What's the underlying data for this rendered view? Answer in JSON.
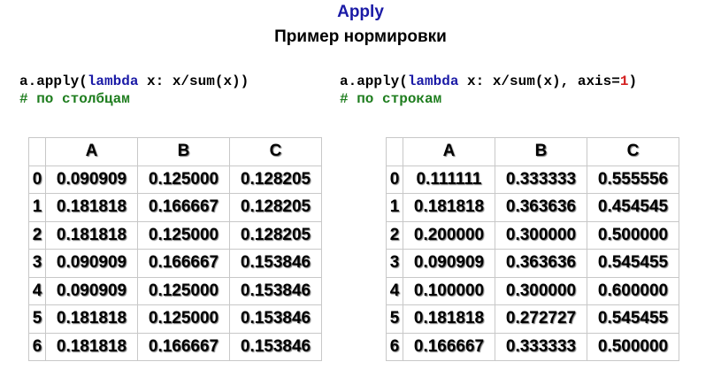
{
  "title": "Apply",
  "subtitle": "Пример нормировки",
  "code_left": {
    "prefix": "a.apply(",
    "keyword": "lambda",
    "suffix": " x: x/sum(x))",
    "comment": "# по столбцам"
  },
  "code_right": {
    "prefix": "a.apply(",
    "keyword": "lambda",
    "middle": " x: x/sum(x), axis=",
    "number": "1",
    "suffix": ")",
    "comment": "# по строкам"
  },
  "table_left": {
    "columns": [
      "",
      "A",
      "B",
      "C"
    ],
    "rows": [
      [
        "0",
        "0.090909",
        "0.125000",
        "0.128205"
      ],
      [
        "1",
        "0.181818",
        "0.166667",
        "0.128205"
      ],
      [
        "2",
        "0.181818",
        "0.125000",
        "0.128205"
      ],
      [
        "3",
        "0.090909",
        "0.166667",
        "0.153846"
      ],
      [
        "4",
        "0.090909",
        "0.125000",
        "0.153846"
      ],
      [
        "5",
        "0.181818",
        "0.125000",
        "0.153846"
      ],
      [
        "6",
        "0.181818",
        "0.166667",
        "0.153846"
      ]
    ]
  },
  "table_right": {
    "columns": [
      "",
      "A",
      "B",
      "C"
    ],
    "rows": [
      [
        "0",
        "0.111111",
        "0.333333",
        "0.555556"
      ],
      [
        "1",
        "0.181818",
        "0.363636",
        "0.454545"
      ],
      [
        "2",
        "0.200000",
        "0.300000",
        "0.500000"
      ],
      [
        "3",
        "0.090909",
        "0.363636",
        "0.545455"
      ],
      [
        "4",
        "0.100000",
        "0.300000",
        "0.600000"
      ],
      [
        "5",
        "0.181818",
        "0.272727",
        "0.545455"
      ],
      [
        "6",
        "0.166667",
        "0.333333",
        "0.500000"
      ]
    ]
  },
  "colors": {
    "title": "#1a1aa6",
    "keyword": "#1a1aa6",
    "number": "#d42020",
    "comment": "#1e7d1e",
    "table_border": "#c8c8c8"
  }
}
